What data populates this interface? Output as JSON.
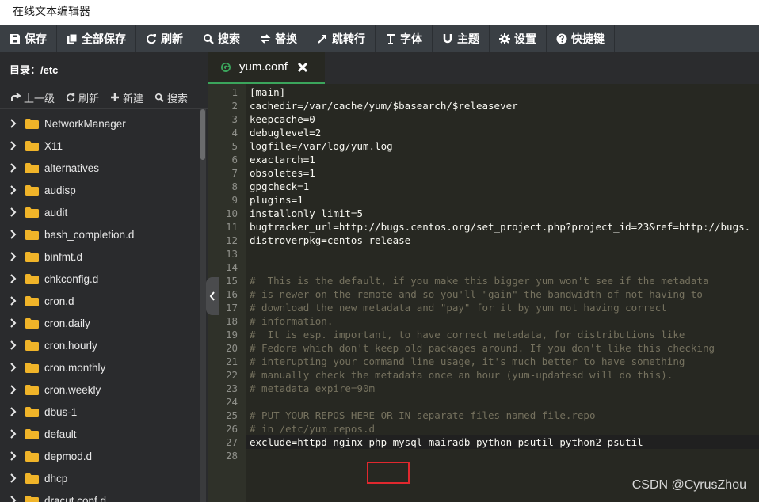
{
  "window": {
    "title": "在线文本编辑器"
  },
  "toolbar": {
    "items": [
      {
        "label": "保存",
        "icon": "save-icon"
      },
      {
        "label": "全部保存",
        "icon": "save-all-icon"
      },
      {
        "label": "刷新",
        "icon": "refresh-icon"
      },
      {
        "label": "搜索",
        "icon": "search-icon"
      },
      {
        "label": "替换",
        "icon": "replace-icon"
      },
      {
        "label": "跳转行",
        "icon": "goto-line-icon"
      },
      {
        "label": "字体",
        "icon": "font-icon"
      },
      {
        "label": "主题",
        "icon": "theme-icon"
      },
      {
        "label": "设置",
        "icon": "gear-icon"
      },
      {
        "label": "快捷键",
        "icon": "help-icon"
      }
    ]
  },
  "sidebar": {
    "directory_label": "目录：/etc",
    "actions": [
      {
        "label": "上一级",
        "icon": "up-level-icon"
      },
      {
        "label": "刷新",
        "icon": "refresh-icon"
      },
      {
        "label": "新建",
        "icon": "plus-icon"
      },
      {
        "label": "搜索",
        "icon": "search-icon"
      }
    ],
    "items": [
      "NetworkManager",
      "X11",
      "alternatives",
      "audisp",
      "audit",
      "bash_completion.d",
      "binfmt.d",
      "chkconfig.d",
      "cron.d",
      "cron.daily",
      "cron.hourly",
      "cron.monthly",
      "cron.weekly",
      "dbus-1",
      "default",
      "depmod.d",
      "dhcp",
      "dracut.conf.d"
    ]
  },
  "editor": {
    "tab": {
      "label": "yum.conf",
      "close": "✖"
    },
    "lines": [
      "[main]",
      "cachedir=/var/cache/yum/$basearch/$releasever",
      "keepcache=0",
      "debuglevel=2",
      "logfile=/var/log/yum.log",
      "exactarch=1",
      "obsoletes=1",
      "gpgcheck=1",
      "plugins=1",
      "installonly_limit=5",
      "bugtracker_url=http://bugs.centos.org/set_project.php?project_id=23&ref=http://bugs.",
      "distroverpkg=centos-release",
      "",
      "",
      "#  This is the default, if you make this bigger yum won't see if the metadata",
      "# is newer on the remote and so you'll \"gain\" the bandwidth of not having to",
      "# download the new metadata and \"pay\" for it by yum not having correct",
      "# information.",
      "#  It is esp. important, to have correct metadata, for distributions like",
      "# Fedora which don't keep old packages around. If you don't like this checking",
      "# interupting your command line usage, it's much better to have something",
      "# manually check the metadata once an hour (yum-updatesd will do this).",
      "# metadata_expire=90m",
      "",
      "# PUT YOUR REPOS HERE OR IN separate files named file.repo",
      "# in /etc/yum.repos.d",
      "exclude=httpd nginx php mysql mairadb python-psutil python2-psutil",
      ""
    ]
  },
  "watermark": "CSDN @CyrusZhou",
  "colors": {
    "accent": "#3ba55c",
    "highlight_box": "#e0282e"
  }
}
